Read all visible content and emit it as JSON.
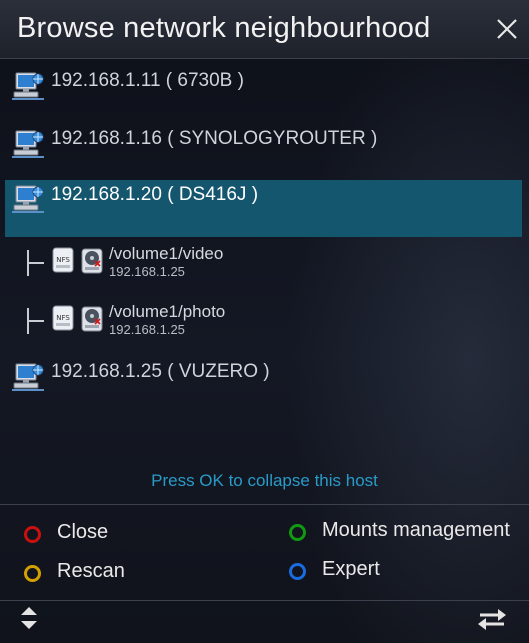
{
  "dialog": {
    "title": "Browse network neighbourhood",
    "close_icon": "close-icon"
  },
  "hosts": [
    {
      "label": "192.168.1.11 ( 6730B )",
      "icon": "network-computer-icon",
      "selected": false
    },
    {
      "label": "192.168.1.16 ( SYNOLOGYROUTER )",
      "icon": "network-computer-icon",
      "selected": false
    },
    {
      "label": "192.168.1.20 ( DS416J )",
      "icon": "network-computer-icon",
      "selected": true
    },
    {
      "label": "192.168.1.25 ( VUZERO )",
      "icon": "network-computer-icon",
      "selected": false
    }
  ],
  "shares": [
    {
      "path": "/volume1/video",
      "ip": "192.168.1.25",
      "type_icon": "nfs-icon",
      "drive_icon": "network-drive-icon"
    },
    {
      "path": "/volume1/photo",
      "ip": "192.168.1.25",
      "type_icon": "nfs-icon",
      "drive_icon": "network-drive-icon"
    }
  ],
  "hint": "Press OK to collapse this host",
  "buttons": {
    "red": {
      "label": "Close",
      "color": "#cc0000"
    },
    "green": {
      "label": "Mounts management",
      "color": "#00a000"
    },
    "yellow": {
      "label": "Rescan",
      "color": "#d4a000"
    },
    "blue": {
      "label": "Expert",
      "color": "#1565d8"
    }
  },
  "footer": {
    "left_icon": "up-down-arrows-icon",
    "right_icon": "swap-arrows-icon"
  },
  "colors": {
    "selection": "#15566f",
    "hint": "#2a9bc8",
    "titlebar": "#262a34"
  }
}
